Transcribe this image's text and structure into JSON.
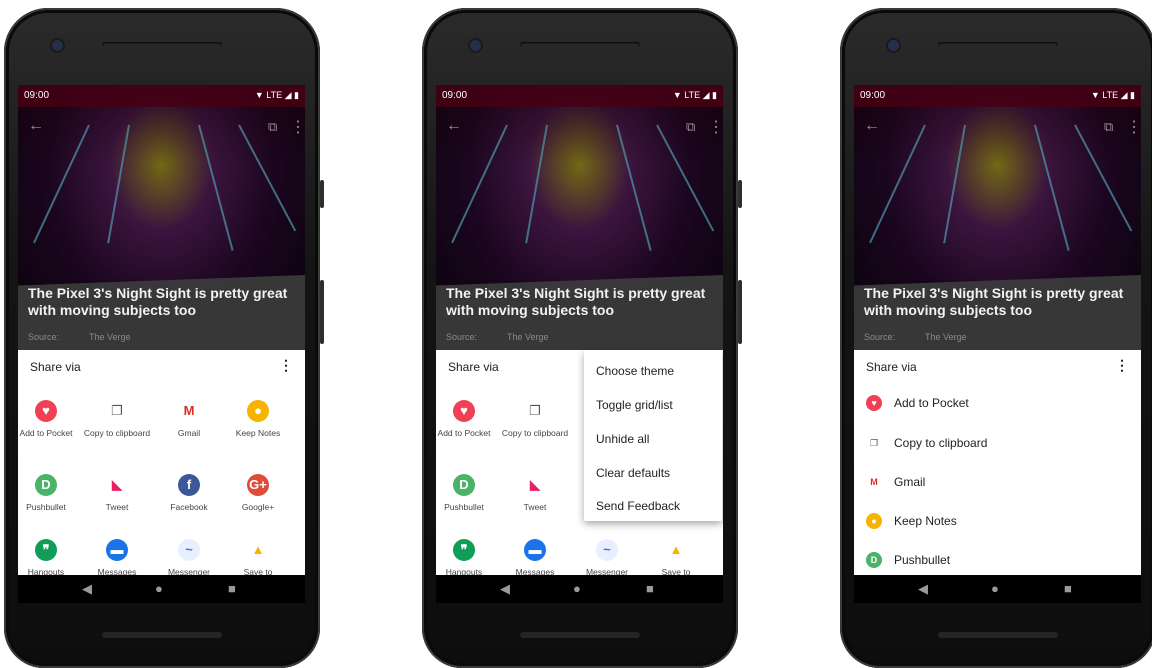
{
  "status": {
    "time": "09:00",
    "icons": "▼ LTE ◢ ▮"
  },
  "article": {
    "title": "The Pixel 3's Night Sight is pretty great with moving subjects too",
    "source_label": "Source:",
    "source_value": "The Verge"
  },
  "share": {
    "title": "Share via",
    "more": "⋮"
  },
  "grid_items": {
    "pocket": "Add to Pocket",
    "clipboard": "Copy to clipboard",
    "gmail": "Gmail",
    "keep": "Keep Notes",
    "pushbullet": "Pushbullet",
    "tweet": "Tweet",
    "facebook": "Facebook",
    "googleplus": "Google+",
    "hangouts": "Hangouts",
    "messages": "Messages",
    "messenger": "Messenger",
    "drive": "Save to"
  },
  "list_items": {
    "pocket": "Add to Pocket",
    "clipboard": "Copy to clipboard",
    "gmail": "Gmail",
    "keep": "Keep Notes",
    "pushbullet": "Pushbullet"
  },
  "menu": {
    "choose_theme": "Choose theme",
    "toggle": "Toggle grid/list",
    "unhide": "Unhide all",
    "clear": "Clear defaults",
    "feedback": "Send Feedback"
  },
  "colors": {
    "pocket": "#ef4056",
    "keep": "#f6b400",
    "pushbullet": "#4ab367",
    "facebook": "#3b5998",
    "googleplus": "#dd4b39",
    "hangouts": "#0f9d58",
    "messages": "#1a73e8"
  },
  "icons": {
    "back": "back-arrow-icon",
    "open": "open-external-icon",
    "more": "overflow-menu-icon",
    "nav_back": "nav-back-icon",
    "nav_home": "nav-home-icon",
    "nav_recents": "nav-recents-icon"
  }
}
